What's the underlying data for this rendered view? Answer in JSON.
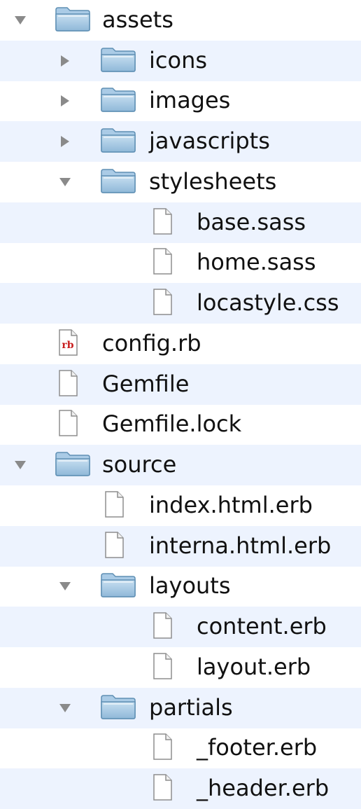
{
  "tree": {
    "rows": [
      {
        "label": "assets",
        "type": "folder",
        "depth": 0,
        "expanded": true
      },
      {
        "label": "icons",
        "type": "folder",
        "depth": 1,
        "expanded": false
      },
      {
        "label": "images",
        "type": "folder",
        "depth": 1,
        "expanded": false
      },
      {
        "label": "javascripts",
        "type": "folder",
        "depth": 1,
        "expanded": false
      },
      {
        "label": "stylesheets",
        "type": "folder",
        "depth": 1,
        "expanded": true
      },
      {
        "label": "base.sass",
        "type": "file",
        "depth": 2
      },
      {
        "label": "home.sass",
        "type": "file",
        "depth": 2
      },
      {
        "label": "locastyle.css",
        "type": "file",
        "depth": 2
      },
      {
        "label": "config.rb",
        "type": "ruby",
        "depth": 0
      },
      {
        "label": "Gemfile",
        "type": "file",
        "depth": 0
      },
      {
        "label": "Gemfile.lock",
        "type": "file",
        "depth": 0
      },
      {
        "label": "source",
        "type": "folder",
        "depth": 0,
        "expanded": true
      },
      {
        "label": "index.html.erb",
        "type": "file",
        "depth": 1
      },
      {
        "label": "interna.html.erb",
        "type": "file",
        "depth": 1
      },
      {
        "label": "layouts",
        "type": "folder",
        "depth": 1,
        "expanded": true
      },
      {
        "label": "content.erb",
        "type": "file",
        "depth": 2
      },
      {
        "label": "layout.erb",
        "type": "file",
        "depth": 2
      },
      {
        "label": "partials",
        "type": "folder",
        "depth": 1,
        "expanded": true
      },
      {
        "label": "_footer.erb",
        "type": "file",
        "depth": 2
      },
      {
        "label": "_header.erb",
        "type": "file",
        "depth": 2
      }
    ],
    "ruby_badge_text": "rb"
  },
  "colors": {
    "alternate_row": "#edf3fe",
    "disclosure_triangle": "#8a8a8a",
    "folder_blue": "#9cc3e2",
    "ruby_red": "#c81e1e"
  }
}
